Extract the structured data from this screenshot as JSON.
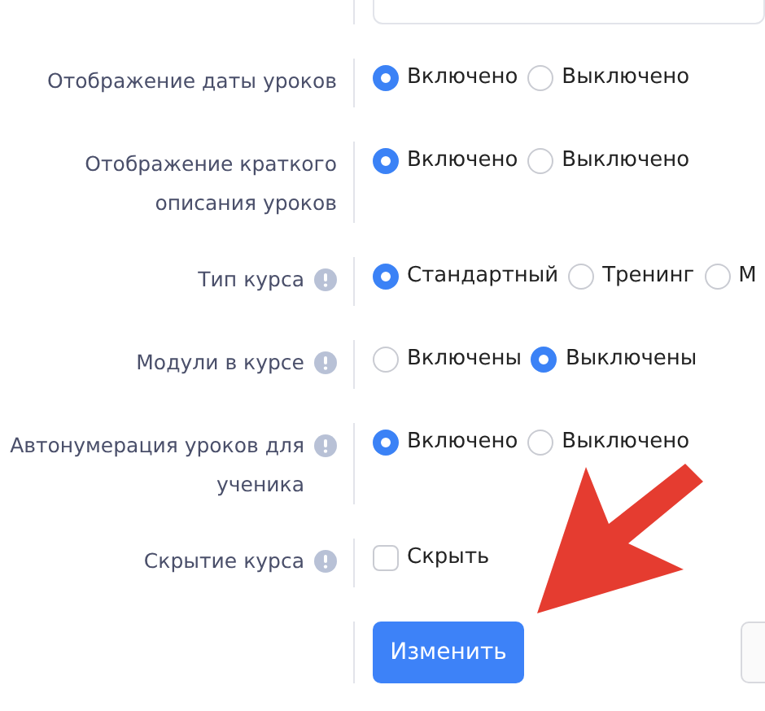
{
  "top_field": {
    "kind": "input"
  },
  "settings": [
    {
      "label": "Отображение даты уроков",
      "info": false,
      "kind": "radio",
      "options": [
        {
          "label": "Включено",
          "selected": true
        },
        {
          "label": "Выключено",
          "selected": false
        }
      ]
    },
    {
      "label": "Отображение краткого описания уроков",
      "info": false,
      "kind": "radio",
      "options": [
        {
          "label": "Включено",
          "selected": true
        },
        {
          "label": "Выключено",
          "selected": false
        }
      ]
    },
    {
      "label": "Тип курса",
      "info": true,
      "kind": "radio",
      "options": [
        {
          "label": "Стандартный",
          "selected": true
        },
        {
          "label": "Тренинг",
          "selected": false
        },
        {
          "label": "М",
          "selected": false
        }
      ]
    },
    {
      "label": "Модули в курсе",
      "info": true,
      "kind": "radio",
      "options": [
        {
          "label": "Включены",
          "selected": false
        },
        {
          "label": "Выключены",
          "selected": true
        }
      ]
    },
    {
      "label": "Автонумерация уроков для ученика",
      "info": true,
      "kind": "radio",
      "options": [
        {
          "label": "Включено",
          "selected": true
        },
        {
          "label": "Выключено",
          "selected": false
        }
      ]
    },
    {
      "label": "Скрытие курса",
      "info": true,
      "kind": "checkbox",
      "options": [
        {
          "label": "Скрыть",
          "checked": false
        }
      ]
    }
  ],
  "buttons": [
    {
      "label": "Изменить",
      "kind": "primary"
    },
    {
      "kind": "secondary"
    }
  ],
  "overlay": {
    "kind": "arrow"
  }
}
